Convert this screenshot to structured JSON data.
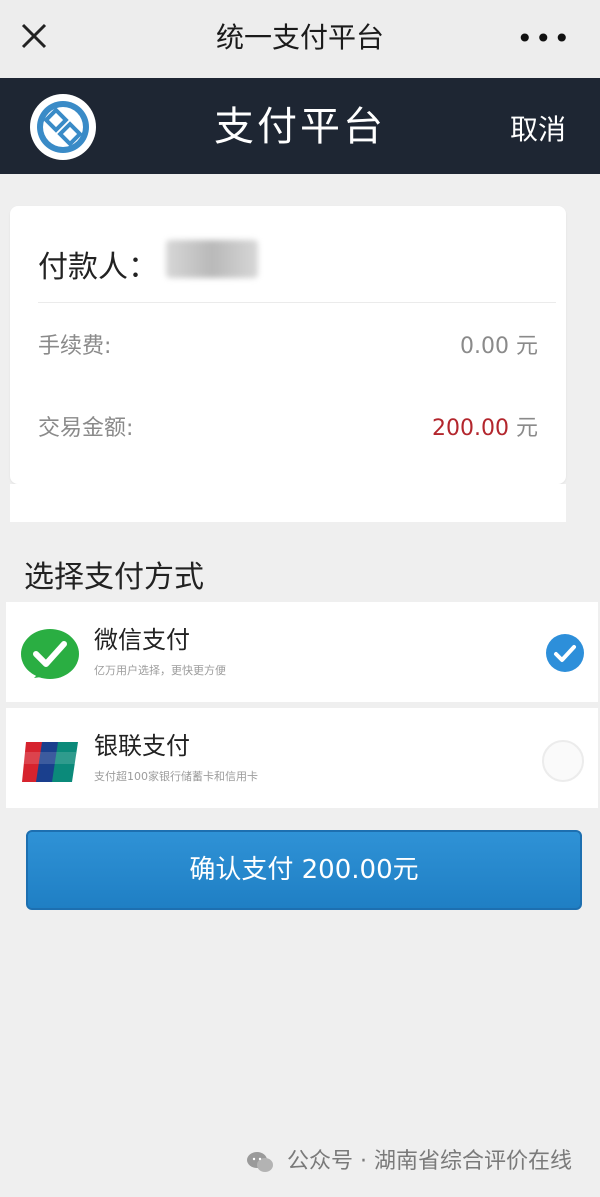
{
  "topbar": {
    "title": "统一支付平台",
    "more": "•••"
  },
  "header": {
    "title": "支付平台",
    "cancel": "取消"
  },
  "card": {
    "payer_label": "付款人：",
    "fee_label": "手续费:",
    "fee_value": "0.00",
    "fee_unit": "元",
    "amount_label": "交易金额:",
    "amount_value": "200.00",
    "amount_unit": "元"
  },
  "section_title": "选择支付方式",
  "payment_methods": [
    {
      "name": "微信支付",
      "desc": "亿万用户选择，更快更方便",
      "selected": true
    },
    {
      "name": "银联支付",
      "desc": "支付超100家银行储蓄卡和信用卡",
      "selected": false
    }
  ],
  "confirm_button": "确认支付 200.00元",
  "footer": "公众号 · 湖南省综合评价在线",
  "colors": {
    "header_bg": "#1e2633",
    "accent": "#2d8fda",
    "amount": "#b3262d",
    "wechat": "#2aae42"
  }
}
